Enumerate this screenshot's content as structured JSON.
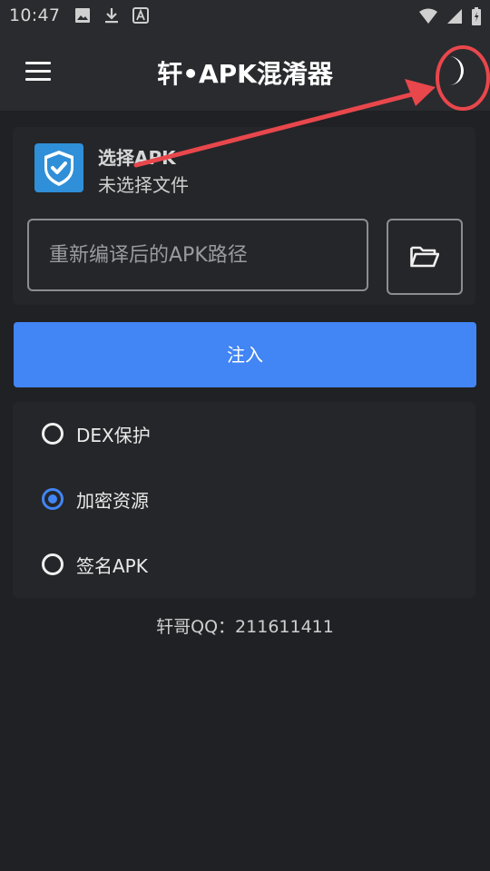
{
  "status_bar": {
    "time": "10:47"
  },
  "app_bar": {
    "title": "轩•APK混淆器"
  },
  "apk_card": {
    "title": "选择APK",
    "subtitle": "未选择文件",
    "path_input": {
      "value": "",
      "placeholder": "重新编译后的APK路径"
    }
  },
  "inject_button": {
    "label": "注入"
  },
  "options": [
    {
      "label": "DEX保护",
      "checked": false
    },
    {
      "label": "加密资源",
      "checked": true
    },
    {
      "label": "签名APK",
      "checked": false
    }
  ],
  "footer": {
    "text": "轩哥QQ：211611411"
  },
  "colors": {
    "background": "#202124",
    "app_bar": "#2a2b2e",
    "card": "#252629",
    "accent": "#4285f4",
    "annotation": "#e8474c"
  },
  "icons": [
    "menu-icon",
    "moon-icon",
    "shield-check-icon",
    "folder-open-icon",
    "wifi-icon",
    "signal-icon",
    "battery-icon",
    "image-icon",
    "download-icon",
    "notification-a-icon"
  ]
}
